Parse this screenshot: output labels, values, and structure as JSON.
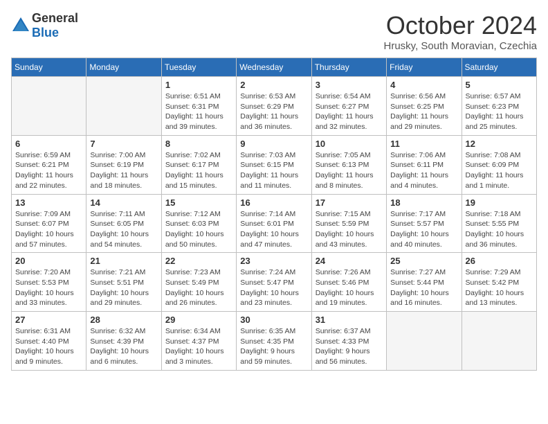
{
  "header": {
    "logo_general": "General",
    "logo_blue": "Blue",
    "month": "October 2024",
    "location": "Hrusky, South Moravian, Czechia"
  },
  "weekdays": [
    "Sunday",
    "Monday",
    "Tuesday",
    "Wednesday",
    "Thursday",
    "Friday",
    "Saturday"
  ],
  "weeks": [
    [
      {
        "day": "",
        "info": ""
      },
      {
        "day": "",
        "info": ""
      },
      {
        "day": "1",
        "info": "Sunrise: 6:51 AM\nSunset: 6:31 PM\nDaylight: 11 hours and 39 minutes."
      },
      {
        "day": "2",
        "info": "Sunrise: 6:53 AM\nSunset: 6:29 PM\nDaylight: 11 hours and 36 minutes."
      },
      {
        "day": "3",
        "info": "Sunrise: 6:54 AM\nSunset: 6:27 PM\nDaylight: 11 hours and 32 minutes."
      },
      {
        "day": "4",
        "info": "Sunrise: 6:56 AM\nSunset: 6:25 PM\nDaylight: 11 hours and 29 minutes."
      },
      {
        "day": "5",
        "info": "Sunrise: 6:57 AM\nSunset: 6:23 PM\nDaylight: 11 hours and 25 minutes."
      }
    ],
    [
      {
        "day": "6",
        "info": "Sunrise: 6:59 AM\nSunset: 6:21 PM\nDaylight: 11 hours and 22 minutes."
      },
      {
        "day": "7",
        "info": "Sunrise: 7:00 AM\nSunset: 6:19 PM\nDaylight: 11 hours and 18 minutes."
      },
      {
        "day": "8",
        "info": "Sunrise: 7:02 AM\nSunset: 6:17 PM\nDaylight: 11 hours and 15 minutes."
      },
      {
        "day": "9",
        "info": "Sunrise: 7:03 AM\nSunset: 6:15 PM\nDaylight: 11 hours and 11 minutes."
      },
      {
        "day": "10",
        "info": "Sunrise: 7:05 AM\nSunset: 6:13 PM\nDaylight: 11 hours and 8 minutes."
      },
      {
        "day": "11",
        "info": "Sunrise: 7:06 AM\nSunset: 6:11 PM\nDaylight: 11 hours and 4 minutes."
      },
      {
        "day": "12",
        "info": "Sunrise: 7:08 AM\nSunset: 6:09 PM\nDaylight: 11 hours and 1 minute."
      }
    ],
    [
      {
        "day": "13",
        "info": "Sunrise: 7:09 AM\nSunset: 6:07 PM\nDaylight: 10 hours and 57 minutes."
      },
      {
        "day": "14",
        "info": "Sunrise: 7:11 AM\nSunset: 6:05 PM\nDaylight: 10 hours and 54 minutes."
      },
      {
        "day": "15",
        "info": "Sunrise: 7:12 AM\nSunset: 6:03 PM\nDaylight: 10 hours and 50 minutes."
      },
      {
        "day": "16",
        "info": "Sunrise: 7:14 AM\nSunset: 6:01 PM\nDaylight: 10 hours and 47 minutes."
      },
      {
        "day": "17",
        "info": "Sunrise: 7:15 AM\nSunset: 5:59 PM\nDaylight: 10 hours and 43 minutes."
      },
      {
        "day": "18",
        "info": "Sunrise: 7:17 AM\nSunset: 5:57 PM\nDaylight: 10 hours and 40 minutes."
      },
      {
        "day": "19",
        "info": "Sunrise: 7:18 AM\nSunset: 5:55 PM\nDaylight: 10 hours and 36 minutes."
      }
    ],
    [
      {
        "day": "20",
        "info": "Sunrise: 7:20 AM\nSunset: 5:53 PM\nDaylight: 10 hours and 33 minutes."
      },
      {
        "day": "21",
        "info": "Sunrise: 7:21 AM\nSunset: 5:51 PM\nDaylight: 10 hours and 29 minutes."
      },
      {
        "day": "22",
        "info": "Sunrise: 7:23 AM\nSunset: 5:49 PM\nDaylight: 10 hours and 26 minutes."
      },
      {
        "day": "23",
        "info": "Sunrise: 7:24 AM\nSunset: 5:47 PM\nDaylight: 10 hours and 23 minutes."
      },
      {
        "day": "24",
        "info": "Sunrise: 7:26 AM\nSunset: 5:46 PM\nDaylight: 10 hours and 19 minutes."
      },
      {
        "day": "25",
        "info": "Sunrise: 7:27 AM\nSunset: 5:44 PM\nDaylight: 10 hours and 16 minutes."
      },
      {
        "day": "26",
        "info": "Sunrise: 7:29 AM\nSunset: 5:42 PM\nDaylight: 10 hours and 13 minutes."
      }
    ],
    [
      {
        "day": "27",
        "info": "Sunrise: 6:31 AM\nSunset: 4:40 PM\nDaylight: 10 hours and 9 minutes."
      },
      {
        "day": "28",
        "info": "Sunrise: 6:32 AM\nSunset: 4:39 PM\nDaylight: 10 hours and 6 minutes."
      },
      {
        "day": "29",
        "info": "Sunrise: 6:34 AM\nSunset: 4:37 PM\nDaylight: 10 hours and 3 minutes."
      },
      {
        "day": "30",
        "info": "Sunrise: 6:35 AM\nSunset: 4:35 PM\nDaylight: 9 hours and 59 minutes."
      },
      {
        "day": "31",
        "info": "Sunrise: 6:37 AM\nSunset: 4:33 PM\nDaylight: 9 hours and 56 minutes."
      },
      {
        "day": "",
        "info": ""
      },
      {
        "day": "",
        "info": ""
      }
    ]
  ]
}
